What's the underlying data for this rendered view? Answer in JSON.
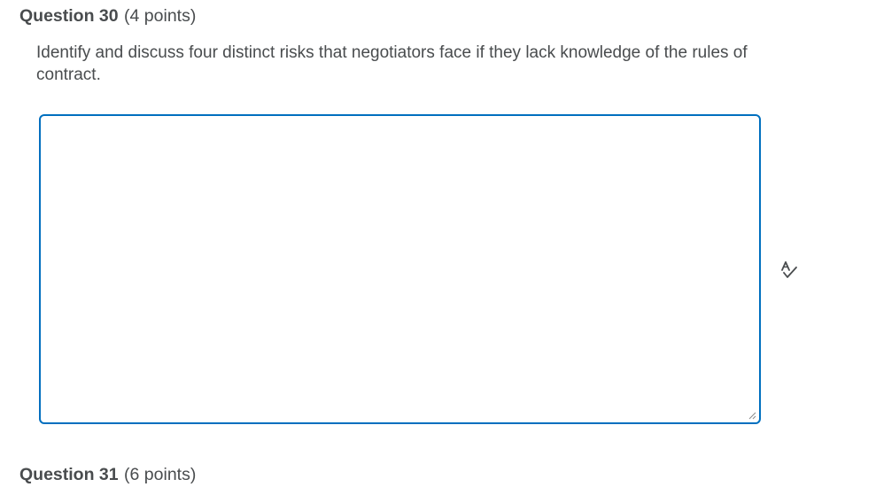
{
  "questions": [
    {
      "title": "Question 30",
      "points": "(4 points)",
      "prompt": "Identify and discuss four distinct risks that negotiators face if they lack knowledge of the rules of contract.",
      "answer": {
        "value": "",
        "placeholder": ""
      },
      "spellcheck_icon": "spellcheck-icon"
    },
    {
      "title": "Question 31",
      "points": "(6 points)"
    }
  ],
  "colors": {
    "text": "#494c4e",
    "focus_border": "#006fbf"
  }
}
